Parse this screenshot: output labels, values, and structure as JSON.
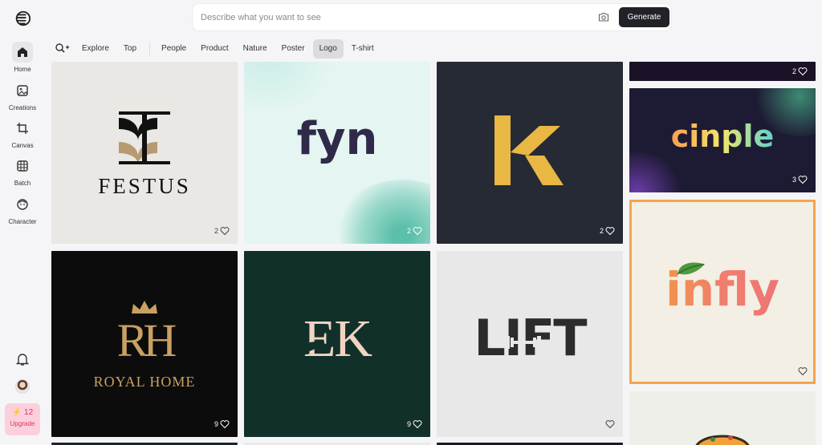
{
  "sidebar": {
    "items": [
      {
        "label": "Home",
        "icon": "home-icon",
        "active": true
      },
      {
        "label": "Creations",
        "icon": "image-icon"
      },
      {
        "label": "Canvas",
        "icon": "canvas-crop-icon"
      },
      {
        "label": "Batch",
        "icon": "grid-icon"
      },
      {
        "label": "Character",
        "icon": "face-icon"
      }
    ],
    "upgrade": {
      "credits": "12",
      "label": "Upgrade",
      "color": "#e4315a"
    }
  },
  "search": {
    "placeholder": "Describe what you want to see",
    "value": "",
    "generate_label": "Generate"
  },
  "tabs": [
    "Explore",
    "Top",
    "People",
    "Product",
    "Nature",
    "Poster",
    "Logo",
    "T-shirt"
  ],
  "active_tab": "Logo",
  "cards": [
    {
      "id": "festus",
      "logo_text": "FESTUS",
      "likes": "2"
    },
    {
      "id": "fyn",
      "logo_text": "fyn",
      "likes": "2"
    },
    {
      "id": "k",
      "logo_text": "K",
      "likes": "2"
    },
    {
      "id": "top-right",
      "likes": "2"
    },
    {
      "id": "cinple",
      "logo_text": "cinple",
      "likes": "3"
    },
    {
      "id": "infly",
      "logo_text": "infly",
      "likes": ""
    },
    {
      "id": "royal-home",
      "logo_text": "ROYAL HOME",
      "likes": "9"
    },
    {
      "id": "ek",
      "logo_text": "EK",
      "likes": "9"
    },
    {
      "id": "lift",
      "logo_text": "LIFT",
      "likes": ""
    }
  ]
}
